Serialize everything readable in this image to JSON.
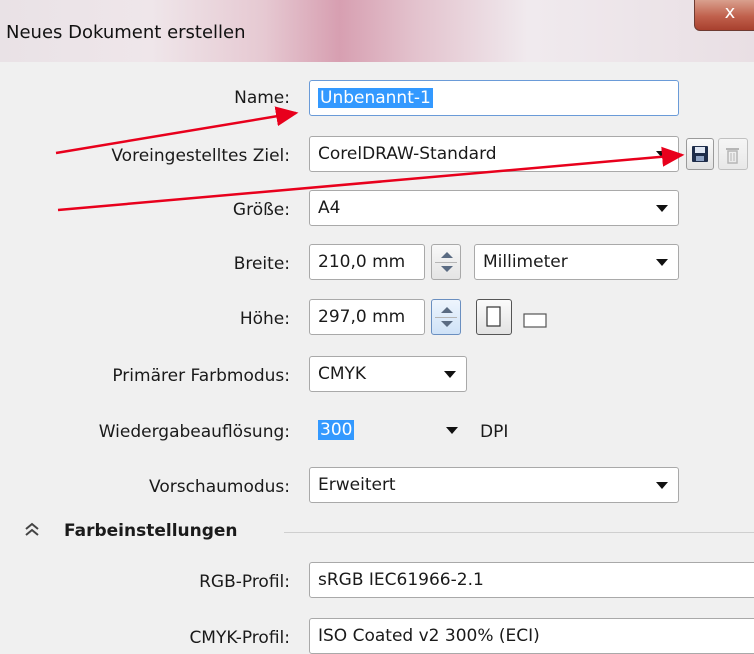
{
  "window": {
    "title": "Neues Dokument erstellen",
    "close_label": "x"
  },
  "form": {
    "name": {
      "label": "Name:",
      "value": "Unbenannt-1"
    },
    "preset": {
      "label": "Voreingestelltes Ziel:",
      "value": "CorelDRAW-Standard"
    },
    "size": {
      "label": "Größe:",
      "value": "A4"
    },
    "width": {
      "label": "Breite:",
      "value": "210,0 mm",
      "unit": "Millimeter"
    },
    "height": {
      "label": "Höhe:",
      "value": "297,0 mm"
    },
    "color_mode": {
      "label": "Primärer Farbmodus:",
      "value": "CMYK"
    },
    "resolution": {
      "label": "Wiedergabeauflösung:",
      "value": "300",
      "unit": "DPI"
    },
    "preview": {
      "label": "Vorschaumodus:",
      "value": "Erweitert"
    }
  },
  "color_settings": {
    "heading": "Farbeinstellungen",
    "rgb_profile": {
      "label": "RGB-Profil:",
      "value": "sRGB IEC61966-2.1"
    },
    "cmyk_profile": {
      "label": "CMYK-Profil:",
      "value": "ISO Coated v2 300% (ECI)"
    }
  },
  "icons": [
    "save-preset-icon",
    "delete-preset-icon",
    "portrait-icon",
    "landscape-icon",
    "collapse-icon"
  ],
  "colors": {
    "selection": "#3399ff",
    "annotation_arrow": "#e8001c"
  }
}
